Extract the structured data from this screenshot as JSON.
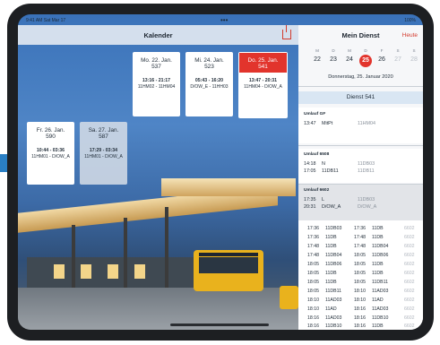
{
  "status": {
    "left": "9:41 AM  Sat Mar 17",
    "center": "•••",
    "right": "100%"
  },
  "calendar": {
    "title": "Kalender"
  },
  "days": [
    {
      "date": "Mo. 22. Jan.",
      "num": "537",
      "time": "13:16 - 21:17",
      "code": "11HM02 - 11HM04"
    },
    {
      "date": "Mi. 24. Jan.",
      "num": "523",
      "time": "05:43 - 16:20",
      "code": "D/OW_E - 11HH03"
    },
    {
      "date": "Do. 25. Jan.",
      "num": "541",
      "time": "13:47 - 20:31",
      "code": "11HM04 - D/OW_A"
    },
    {
      "date": "Fr. 26. Jan.",
      "num": "590",
      "time": "10:44 - 03:36",
      "code": "11HM01 - D/OW_A"
    },
    {
      "date": "Sa. 27. Jan.",
      "num": "587",
      "time": "17:29 - 03:34",
      "code": "11HM01 - D/OW_A"
    }
  ],
  "dienst": {
    "title": "Mein Dienst",
    "today": "Heute",
    "weekdays": [
      "M",
      "D",
      "M",
      "D",
      "F",
      "S",
      "S"
    ],
    "days": [
      "22",
      "23",
      "24",
      "25",
      "26",
      "27",
      "28"
    ],
    "selected_date": "Donnerstag, 25. Januar 2020",
    "label": "Dienst 541",
    "umlaeufe": [
      {
        "head": "Umlauf GF",
        "rows": [
          {
            "time": "13:47",
            "a": "MitPt",
            "b": "11HM04"
          }
        ]
      },
      {
        "head": "Umlauf 6508",
        "rows": [
          {
            "time": "14:18",
            "a": "N",
            "b": "11DB03"
          },
          {
            "time": "17:05",
            "a": "11DB11",
            "b": "11DB11"
          }
        ]
      },
      {
        "head": "Umlauf 6602",
        "rows": [
          {
            "time": "17:35",
            "a": "L",
            "b": "11DB03"
          },
          {
            "time": "20:31",
            "a": "D/OW_A",
            "b": "D/OW_A"
          }
        ]
      }
    ],
    "timeline": [
      [
        "17:36",
        "11DB03",
        "17:36",
        "11DB",
        "6602"
      ],
      [
        "17:36",
        "11DB",
        "17:48",
        "11DB",
        "6602"
      ],
      [
        "17:48",
        "11DB",
        "17:48",
        "11DB04",
        "6602"
      ],
      [
        "17:48",
        "11DB04",
        "18:05",
        "11DB06",
        "6602"
      ],
      [
        "18:05",
        "11DB06",
        "18:05",
        "11DB",
        "6602"
      ],
      [
        "18:05",
        "11DB",
        "18:05",
        "11DB",
        "6602"
      ],
      [
        "18:05",
        "11DB",
        "18:05",
        "11DB11",
        "6602"
      ],
      [
        "18:05",
        "11DB11",
        "18:10",
        "11AD03",
        "6602"
      ],
      [
        "18:10",
        "11AD03",
        "18:10",
        "11AD",
        "6602"
      ],
      [
        "18:10",
        "11AD",
        "18:16",
        "11AD03",
        "6602"
      ],
      [
        "18:16",
        "11AD03",
        "18:16",
        "11DB10",
        "6602"
      ],
      [
        "18:16",
        "11DB10",
        "18:16",
        "11DB",
        "6602"
      ]
    ]
  }
}
